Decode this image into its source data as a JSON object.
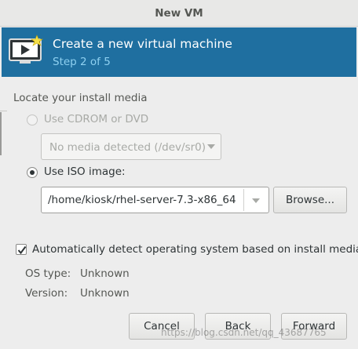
{
  "window": {
    "title": "New VM"
  },
  "header": {
    "title": "Create a new virtual machine",
    "step": "Step 2 of 5"
  },
  "media": {
    "section_label": "Locate your install media",
    "cdrom_label": "Use CDROM or DVD",
    "cdrom_select_value": "No media detected (/dev/sr0)",
    "iso_label": "Use ISO image:",
    "iso_path": "/home/kiosk/rhel-server-7.3-x86_64",
    "browse_label": "Browse..."
  },
  "detect": {
    "checkbox_label": "Automatically detect operating system based on install media",
    "checked": true,
    "os_type_key": "OS type:",
    "os_type_value": "Unknown",
    "version_key": "Version:",
    "version_value": "Unknown"
  },
  "footer": {
    "cancel_label": "Cancel",
    "back_label": "Back",
    "forward_label": "Forward"
  },
  "watermark": "https://blog.csdn.net/qq_43687765",
  "colors": {
    "banner": "#1f6fa0",
    "step": "#8ed0f0"
  },
  "icons": {
    "header": "monitor-play-icon"
  }
}
